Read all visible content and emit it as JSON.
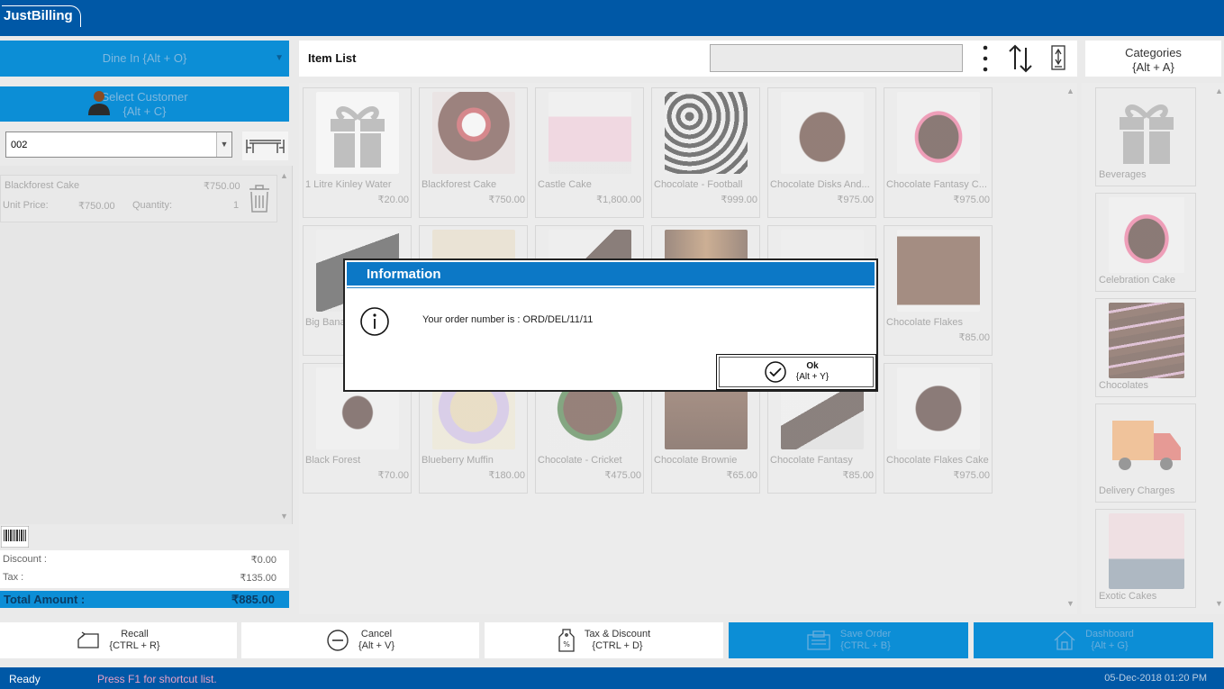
{
  "app": {
    "logo_text": "JustBilling"
  },
  "left_panel": {
    "dine_in_label": "Dine In {Alt + O}",
    "select_customer_line1": "Select Customer",
    "select_customer_line2": "{Alt + C}",
    "order_select_value": "002",
    "cart_items": [
      {
        "name": "Blackforest Cake",
        "total": "₹750.00",
        "unit_price_label": "Unit Price:",
        "unit_price": "₹750.00",
        "quantity_label": "Quantity:",
        "quantity": "1"
      }
    ],
    "discount_label": "Discount :",
    "discount_value": "₹0.00",
    "tax_label": "Tax :",
    "tax_value": "₹135.00",
    "total_label": "Total Amount :",
    "total_value": "₹885.00"
  },
  "item_list": {
    "title": "Item List",
    "search_value": "",
    "items": [
      {
        "name": "1 Litre Kinley Water",
        "price": "₹20.00"
      },
      {
        "name": "Blackforest Cake",
        "price": "₹750.00"
      },
      {
        "name": "Castle Cake",
        "price": "₹1,800.00"
      },
      {
        "name": "Chocolate - Football",
        "price": "₹999.00"
      },
      {
        "name": "Chocolate Disks And...",
        "price": "₹975.00"
      },
      {
        "name": "Chocolate Fantasy C...",
        "price": "₹975.00"
      },
      {
        "name": "Big Banana",
        "price": ""
      },
      {
        "name": "",
        "price": ""
      },
      {
        "name": "",
        "price": ""
      },
      {
        "name": "",
        "price": ""
      },
      {
        "name": "",
        "price": ""
      },
      {
        "name": "Chocolate Flakes",
        "price": "₹85.00"
      },
      {
        "name": "Black Forest",
        "price": "₹70.00"
      },
      {
        "name": "Blueberry Muffin",
        "price": "₹180.00"
      },
      {
        "name": "Chocolate - Cricket",
        "price": "₹475.00"
      },
      {
        "name": "Chocolate Brownie",
        "price": "₹65.00"
      },
      {
        "name": "Chocolate Fantasy",
        "price": "₹85.00"
      },
      {
        "name": "Chocolate Flakes Cake",
        "price": "₹975.00"
      }
    ]
  },
  "categories": {
    "button_line1": "Categories",
    "button_line2": "{Alt + A}",
    "items": [
      {
        "name": "Beverages"
      },
      {
        "name": "Celebration Cake"
      },
      {
        "name": "Chocolates"
      },
      {
        "name": "Delivery Charges"
      },
      {
        "name": "Exotic Cakes"
      }
    ]
  },
  "toolbar": {
    "recall_label": "Recall",
    "recall_shortcut": "{CTRL + R}",
    "cancel_label": "Cancel",
    "cancel_shortcut": "{Alt + V}",
    "tax_discount_label": "Tax & Discount",
    "tax_discount_shortcut": "{CTRL + D}",
    "save_order_label": "Save Order",
    "save_order_shortcut": "{CTRL + B}",
    "dashboard_label": "Dashboard",
    "dashboard_shortcut": "{Alt + G}"
  },
  "status": {
    "ready": "Ready",
    "hint": "Press F1 for shortcut list.",
    "datetime": "05-Dec-2018 01:20 PM"
  },
  "dialog": {
    "title": "Information",
    "message": "Your order number is : ORD/DEL/11/11",
    "ok_label": "Ok",
    "ok_shortcut": "{Alt + Y}"
  },
  "colors": {
    "brand_blue": "#0058a6",
    "accent_blue": "#0c8ed6",
    "dialog_header": "#0c78c6"
  }
}
